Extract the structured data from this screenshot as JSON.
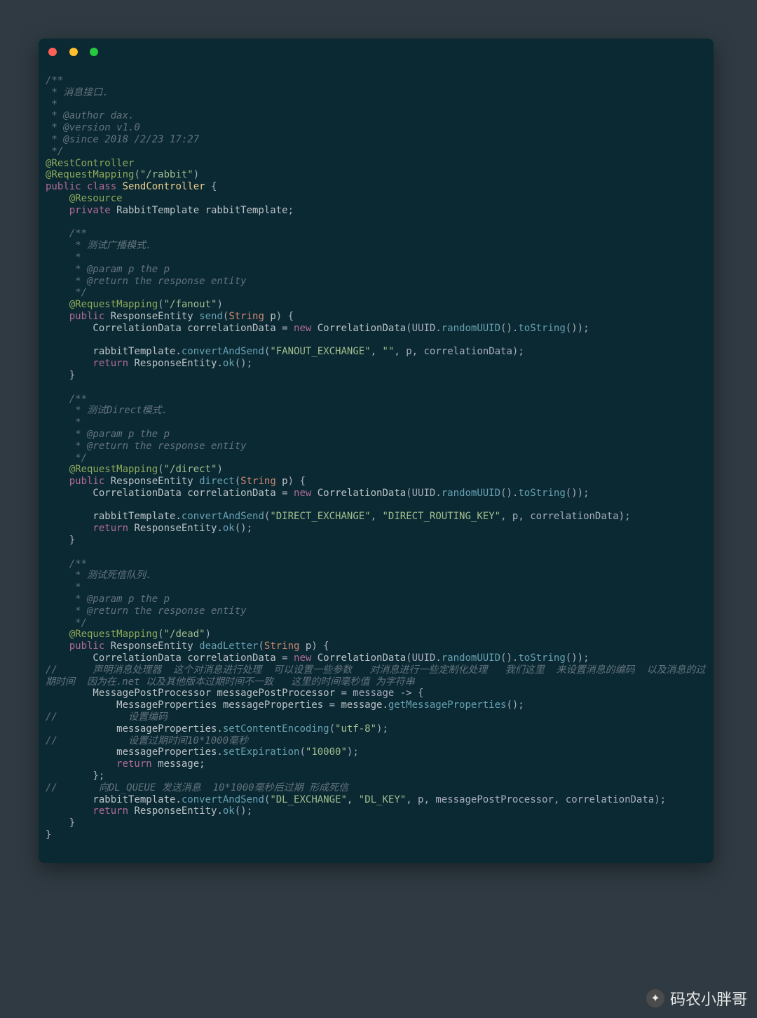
{
  "watermark": {
    "label": "码农小胖哥"
  },
  "code": {
    "l01": "/**",
    "l02": " * 消息接口.",
    "l03": " *",
    "l04": " * @author dax.",
    "l05": " * @version v1.0",
    "l06": " * @since 2018 /2/23 17:27",
    "l07": " */",
    "l08": {
      "anno": "@RestController"
    },
    "l09": {
      "anno": "@RequestMapping",
      "open": "(",
      "str": "\"/rabbit\"",
      "close": ")"
    },
    "l10": {
      "kw1": "public",
      "kw2": "class",
      "cls": "SendController",
      "brace": " {"
    },
    "l11": {
      "anno": "    @Resource"
    },
    "l12": {
      "kw": "    private",
      "t": " RabbitTemplate rabbitTemplate",
      ";": ";"
    },
    "l13": "",
    "l14": "    /**",
    "l15": "     * 测试广播模式.",
    "l16": "     *",
    "l17": "     * @param p the p",
    "l18": "     * @return the response entity",
    "l19": "     */",
    "l20": {
      "anno": "    @RequestMapping",
      "open": "(",
      "str": "\"/fanout\"",
      "close": ")"
    },
    "l21": {
      "kw": "    public",
      "ret": " ResponseEntity ",
      "fn": "send",
      "open": "(",
      "ptype": "String",
      "pvar": " p",
      "close": ") {"
    },
    "l22": {
      "lead": "        CorrelationData correlationData ",
      "eq": "=",
      "new": " new",
      "ctor": " CorrelationData",
      "open": "(UUID.",
      "call1": "randomUUID",
      "mid": "().",
      "call2": "toString",
      "close": "());"
    },
    "l23": "",
    "l24": {
      "lead": "        rabbitTemplate.",
      "call": "convertAndSend",
      "open": "(",
      "str1": "\"FANOUT_EXCHANGE\"",
      "c1": ", ",
      "str2": "\"\"",
      "c2": ", p, correlationData);"
    },
    "l25": {
      "kw": "        return",
      "rest": " ResponseEntity.",
      "call": "ok",
      "close": "();"
    },
    "l26": "    }",
    "l27": "",
    "l28": "    /**",
    "l29": "     * 测试Direct模式.",
    "l30": "     *",
    "l31": "     * @param p the p",
    "l32": "     * @return the response entity",
    "l33": "     */",
    "l34": {
      "anno": "    @RequestMapping",
      "open": "(",
      "str": "\"/direct\"",
      "close": ")"
    },
    "l35": {
      "kw": "    public",
      "ret": " ResponseEntity ",
      "fn": "direct",
      "open": "(",
      "ptype": "String",
      "pvar": " p",
      "close": ") {"
    },
    "l36": {
      "lead": "        CorrelationData correlationData ",
      "eq": "=",
      "new": " new",
      "ctor": " CorrelationData",
      "open": "(UUID.",
      "call1": "randomUUID",
      "mid": "().",
      "call2": "toString",
      "close": "());"
    },
    "l37": "",
    "l38": {
      "lead": "        rabbitTemplate.",
      "call": "convertAndSend",
      "open": "(",
      "str1": "\"DIRECT_EXCHANGE\"",
      "c1": ", ",
      "str2": "\"DIRECT_ROUTING_KEY\"",
      "c2": ", p, correlationData);"
    },
    "l39": {
      "kw": "        return",
      "rest": " ResponseEntity.",
      "call": "ok",
      "close": "();"
    },
    "l40": "    }",
    "l41": "",
    "l42": "    /**",
    "l43": "     * 测试死信队列.",
    "l44": "     *",
    "l45": "     * @param p the p",
    "l46": "     * @return the response entity",
    "l47": "     */",
    "l48": {
      "anno": "    @RequestMapping",
      "open": "(",
      "str": "\"/dead\"",
      "close": ")"
    },
    "l49": {
      "kw": "    public",
      "ret": " ResponseEntity ",
      "fn": "deadLetter",
      "open": "(",
      "ptype": "String",
      "pvar": " p",
      "close": ") {"
    },
    "l50": {
      "lead": "        CorrelationData correlationData ",
      "eq": "=",
      "new": " new",
      "ctor": " CorrelationData",
      "open": "(UUID.",
      "call1": "randomUUID",
      "mid": "().",
      "call2": "toString",
      "close": "());"
    },
    "l51": "//      声明消息处理器  这个对消息进行处理  可以设置一些参数   对消息进行一些定制化处理   我们这里  来设置消息的编码  以及消息的过期时间  因为在.net 以及其他版本过期时间不一致   这里的时间毫秒值 为字符串",
    "l52": {
      "lead": "        MessagePostProcessor messagePostProcessor ",
      "eq": "=",
      "rest": " message -> {"
    },
    "l53": {
      "lead": "            MessageProperties messageProperties ",
      "eq": "=",
      "rest": " message.",
      "call": "getMessageProperties",
      "close": "();"
    },
    "l54": "//            设置编码",
    "l55": {
      "lead": "            messageProperties.",
      "call": "setContentEncoding",
      "open": "(",
      "str": "\"utf-8\"",
      "close": ");"
    },
    "l56": "//            设置过期时间10*1000毫秒",
    "l57": {
      "lead": "            messageProperties.",
      "call": "setExpiration",
      "open": "(",
      "str": "\"10000\"",
      "close": ");"
    },
    "l58": {
      "kw": "            return",
      "rest": " message;"
    },
    "l59": "        };",
    "l60": "//       向DL_QUEUE 发送消息  10*1000毫秒后过期 形成死信",
    "l61": {
      "lead": "        rabbitTemplate.",
      "call": "convertAndSend",
      "open": "(",
      "str1": "\"DL_EXCHANGE\"",
      "c1": ", ",
      "str2": "\"DL_KEY\"",
      "c2": ", p, messagePostProcessor, correlationData);"
    },
    "l62": {
      "kw": "        return",
      "rest": " ResponseEntity.",
      "call": "ok",
      "close": "();"
    },
    "l63": "    }",
    "l64": "}"
  }
}
